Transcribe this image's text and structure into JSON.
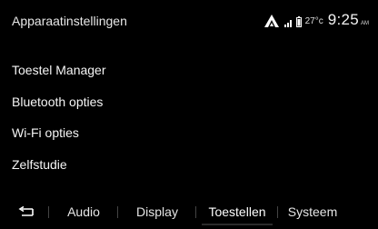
{
  "header": {
    "title": "Apparaatinstellingen",
    "temperature": "27°c",
    "time": "9:25",
    "ampm": "AM",
    "icons": [
      "brand-logo-icon",
      "signal-icon",
      "battery-icon"
    ]
  },
  "menu": {
    "items": [
      {
        "label": "Toestel Manager"
      },
      {
        "label": "Bluetooth opties"
      },
      {
        "label": "Wi-Fi opties"
      },
      {
        "label": "Zelfstudie"
      }
    ]
  },
  "tabs": [
    {
      "label": "Audio"
    },
    {
      "label": "Display"
    },
    {
      "label": "Toestellen",
      "selected": true
    },
    {
      "label": "Systeem"
    }
  ],
  "back_icon": "back-arrow-icon"
}
